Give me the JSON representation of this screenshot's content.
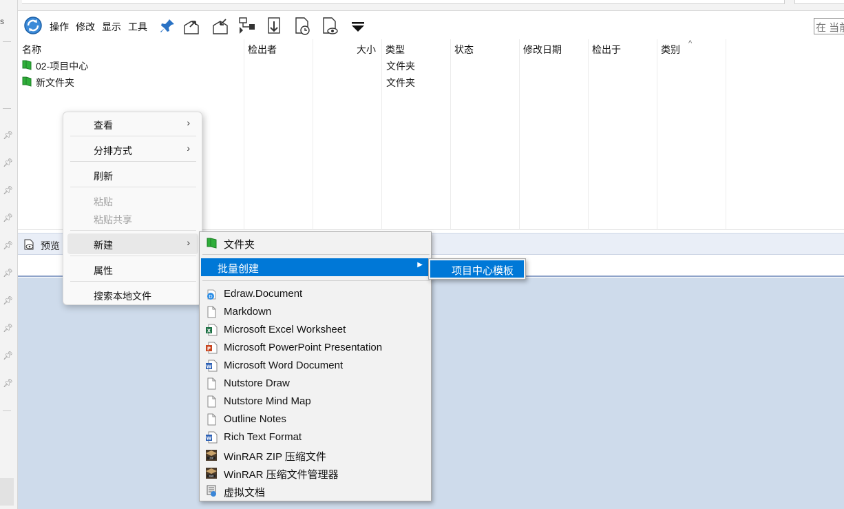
{
  "left_strip": {
    "edge_mark": "s"
  },
  "toolbar": {
    "menus": [
      "操作",
      "修改",
      "显示",
      "工具"
    ],
    "search_placeholder": "在 当前"
  },
  "file_list": {
    "columns": [
      "名称",
      "检出者",
      "大小",
      "类型",
      "状态",
      "修改日期",
      "检出于",
      "类别"
    ],
    "rows": [
      {
        "name": "02-项目中心",
        "type": "文件夹"
      },
      {
        "name": "新文件夹",
        "type": "文件夹"
      }
    ]
  },
  "preview": {
    "label": "预览"
  },
  "context_menu": {
    "items": [
      {
        "label": "查看",
        "submenu": true
      },
      {
        "label": "分排方式",
        "submenu": true
      },
      {
        "label": "刷新"
      },
      {
        "label": "粘贴",
        "disabled": true
      },
      {
        "label": "粘贴共享",
        "disabled": true
      },
      {
        "label": "新建",
        "submenu": true
      },
      {
        "label": "属性"
      },
      {
        "label": "搜索本地文件"
      }
    ]
  },
  "new_submenu": {
    "folder": "文件夹",
    "batch": "批量创建",
    "items": [
      {
        "label": "Edraw.Document",
        "icon": "edraw-icon"
      },
      {
        "label": "Markdown",
        "icon": "blank-doc-icon"
      },
      {
        "label": "Microsoft Excel Worksheet",
        "icon": "excel-icon"
      },
      {
        "label": "Microsoft PowerPoint Presentation",
        "icon": "powerpoint-icon"
      },
      {
        "label": "Microsoft Word Document",
        "icon": "word-icon"
      },
      {
        "label": "Nutstore Draw",
        "icon": "blank-doc-icon"
      },
      {
        "label": "Nutstore Mind Map",
        "icon": "blank-doc-icon"
      },
      {
        "label": "Outline Notes",
        "icon": "blank-doc-icon"
      },
      {
        "label": "Rich Text Format",
        "icon": "word-icon"
      },
      {
        "label": "WinRAR ZIP 压缩文件",
        "icon": "winrar-icon"
      },
      {
        "label": "WinRAR 压缩文件管理器",
        "icon": "winrar-icon"
      },
      {
        "label": "虚拟文档",
        "icon": "virtual-doc-icon"
      }
    ]
  },
  "batch_submenu": {
    "item": "项目中心模板"
  },
  "colors": {
    "highlight": "#0078d7",
    "preview_area": "#cedbeb",
    "folder_green": "#2fae3a"
  }
}
